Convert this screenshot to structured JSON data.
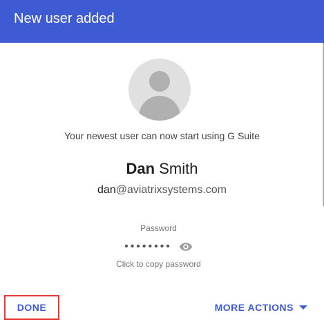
{
  "header": {
    "title": "New user added"
  },
  "main": {
    "message": "Your newest user can now start using G Suite",
    "user": {
      "first_name": "Dan",
      "last_name": "Smith",
      "email_user": "dan",
      "email_domain": "@aviatrixsystems.com"
    },
    "password": {
      "label": "Password",
      "masked_value": "••••••••",
      "copy_hint": "Click to copy password"
    }
  },
  "footer": {
    "done_label": "DONE",
    "more_actions_label": "MORE ACTIONS"
  },
  "colors": {
    "header_bg": "#3f5bd4",
    "accent": "#3f5bd4",
    "highlight_border": "#e53935"
  },
  "icons": {
    "avatar": "person-avatar-icon",
    "show_password": "eye-icon",
    "more_actions": "caret-down-icon"
  }
}
